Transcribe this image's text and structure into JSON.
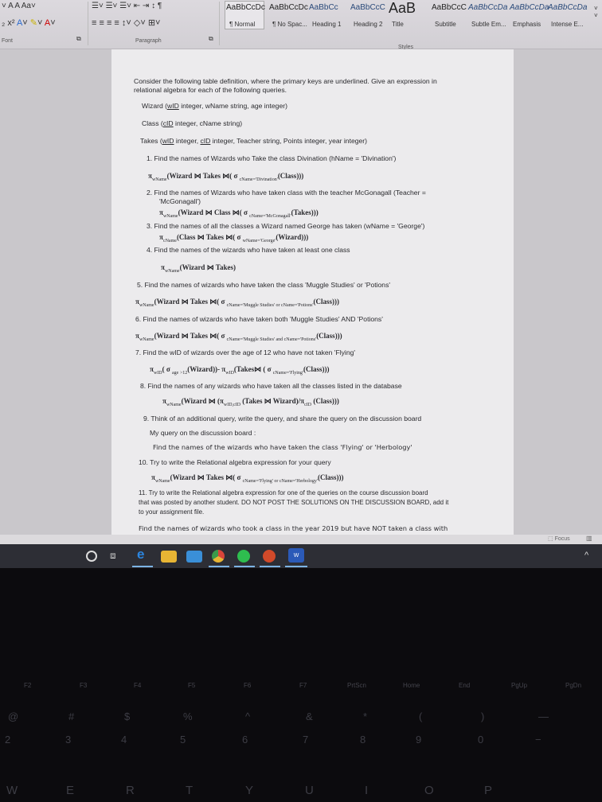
{
  "ribbon": {
    "font_group": "Font",
    "paragraph_group": "Paragraph",
    "styles_group": "Styles",
    "styles": [
      {
        "preview": "AaBbCcDc",
        "name": "¶ Normal"
      },
      {
        "preview": "AaBbCcDc",
        "name": "¶ No Spac..."
      },
      {
        "preview": "AaBbCc",
        "name": "Heading 1"
      },
      {
        "preview": "AaBbCcC",
        "name": "Heading 2"
      },
      {
        "preview": "AaB",
        "name": "Title"
      },
      {
        "preview": "AaBbCcC",
        "name": "Subtitle"
      },
      {
        "preview": "AaBbCcDa",
        "name": "Subtle Em..."
      },
      {
        "preview": "AaBbCcDa",
        "name": "Emphasis"
      },
      {
        "preview": "AaBbCcDa",
        "name": "Intense E..."
      }
    ]
  },
  "document": {
    "intro": [
      "Consider the following table definition, where the primary keys are underlined. Give an expression in",
      "relational algebra for each of the following queries."
    ],
    "tables": {
      "wizard": {
        "name": "Wizard (",
        "k": "wID",
        "rest": " integer, wName string, age integer)"
      },
      "class": {
        "name": "Class (",
        "k": "cID",
        "rest": " integer, cName string)"
      },
      "takes": {
        "name": "Takes (",
        "k": "wID",
        "mid": " integer, ",
        "k2": "cID",
        "rest": " integer, Teacher string, Points integer, year integer)"
      }
    },
    "q1": "1.   Find the names of Wizards who Take the class Divination (hName = 'Divination')",
    "e1": {
      "a": "π",
      "as": "wName",
      "b": "(Wizard ⋈ Takes ⋈( σ ",
      "bs": "cName='Divination'",
      "c": "(Class)))"
    },
    "q2a": "2.   Find the names of Wizards who have taken  class with the teacher McGonagall (Teacher =",
    "q2b": "'McGonagall')",
    "e2": {
      "a": "π",
      "as": "wName",
      "b": "(Wizard ⋈ Class ⋈( σ ",
      "bs": "cName='McGonagall'",
      "c": "(Takes)))"
    },
    "q3": "3.   Find the names of all the classes a Wizard named George has taken (wName = 'George')",
    "e3": {
      "a": "π",
      "as": "cName",
      "b": "(Class ⋈ Takes ⋈( σ ",
      "bs": "wName='George'",
      "c": "(Wizard)))"
    },
    "q4": "4.   Find the names of the wizards who have taken at least one class",
    "e4": {
      "a": "π",
      "as": "wName",
      "b": "(Wizard ⋈ Takes)",
      "bs": "",
      "c": ""
    },
    "q5": "5. Find the names of wizards  who have taken the class  'Muggle Studies' or 'Potions'",
    "e5": {
      "a": "π",
      "as": "wName",
      "b": "(Wizard ⋈ Takes ⋈( σ ",
      "bs": "cName='Muggle Studies' or cName='Potions'",
      "c": "(Class)))"
    },
    "q6": "6. Find the names of wizards  who have taken both  'Muggle Studies' AND 'Potions'",
    "e6": {
      "a": "π",
      "as": "wName",
      "b": "(Wizard ⋈ Takes ⋈( σ ",
      "bs": "cName='Muggle Studies' and cName='Potions'",
      "c": "(Class)))"
    },
    "q7": "7. Find the wID of wizards over the age of 12 who have not taken 'Flying'",
    "e7": {
      "a": "π",
      "as": "wID",
      "b": "( σ ",
      "bs": "age >12",
      "c": "(Wizard))- π",
      "cs": "wID",
      "d": "(Takes⋈ ( σ ",
      "ds": "cName='Flying'",
      "e": "(Class)))"
    },
    "q8": "8. Find the names of any wizards who have taken all the classes listed in the database",
    "e8": {
      "a": "π",
      "as": "wName",
      "b": "(Wizard ⋈ (π",
      "bs": "wID,cID",
      "c": " (Takes  ⋈ Wizard)/π",
      "cs": "cID",
      "d": " (Class)))"
    },
    "q9": "9. Think of an additional query, write the query, and share the query on the discussion board",
    "q9_label": "My query on the discussion board :",
    "q9_query": "Find the names of the wizards who have taken the class 'Flying' or 'Herbology'",
    "q10": "10. Try to write the Relational algebra expression for your query",
    "e10": {
      "a": "π",
      "as": "wName",
      "b": "(Wizard ⋈ Takes ⋈( σ ",
      "bs": "cName='Flying' or cName='Herbology'",
      "c": "(Class)))"
    },
    "q11": [
      "11. Try to write the Relational algebra expression for one of the queries on the course discussion board",
      "that was posted by another student. DO NOT POST THE SOLUTIONS ON THE DISCUSSION BOARD, add it",
      "to your assignment file."
    ],
    "q11_query": "Find the names of wizards who took a class in the year 2019 but have NOT taken a class with"
  },
  "statusbar": {
    "focus": "Focus"
  },
  "taskbar": {
    "apps": [
      "cortana",
      "task-view",
      "edge",
      "file-explorer",
      "mail",
      "chrome",
      "spotify",
      "powerpoint",
      "word"
    ],
    "word_label": "W"
  },
  "keyboard": {
    "fkeys": [
      "F2",
      "F3",
      "F4",
      "F5",
      "F6",
      "F7",
      "PrtScn",
      "Home",
      "End",
      "PgUp",
      "PgDn"
    ],
    "symbols": [
      "@",
      "#",
      "$",
      "%",
      "^",
      "&",
      "*",
      "(",
      ")",
      "—"
    ],
    "digits": [
      "2",
      "3",
      "4",
      "5",
      "6",
      "7",
      "8",
      "9",
      "0",
      "−"
    ],
    "letters": [
      "W",
      "E",
      "R",
      "T",
      "Y",
      "U",
      "I",
      "O",
      "P"
    ]
  }
}
